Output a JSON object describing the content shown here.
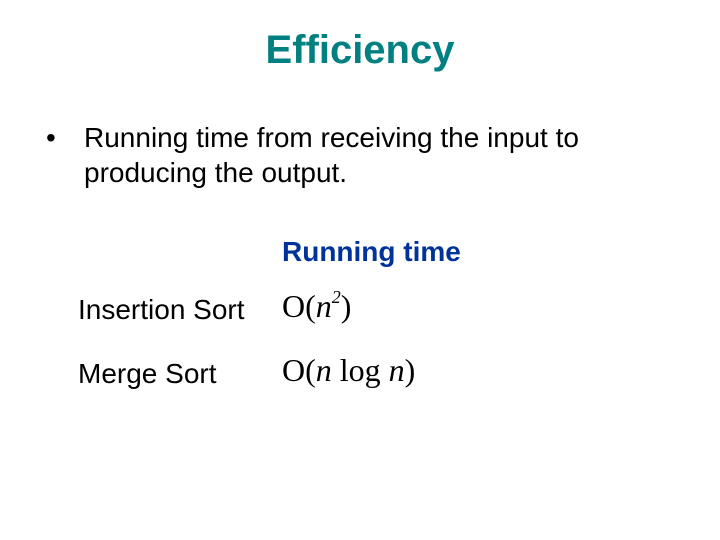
{
  "title": "Efficiency",
  "bullet": {
    "marker": "•",
    "text": "Running time from receiving the input to producing the output."
  },
  "table": {
    "header": "Running time",
    "rows": [
      {
        "label": "Insertion Sort",
        "bigO_var": "n",
        "bigO_exp": "2",
        "bigO_suffix": ""
      },
      {
        "label": "Merge Sort",
        "bigO_var": "n",
        "bigO_exp": "",
        "bigO_suffix": "log n"
      }
    ]
  }
}
